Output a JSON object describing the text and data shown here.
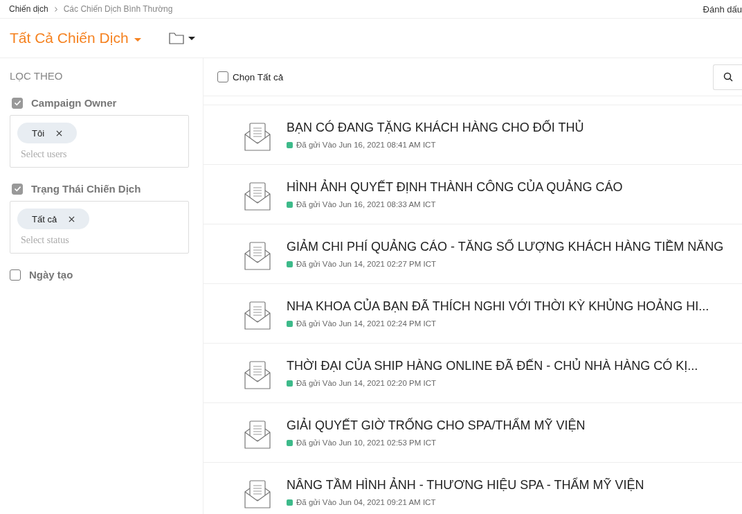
{
  "breadcrumb": {
    "items": [
      "Chiến dịch",
      "Các Chiến Dịch Bình Thường"
    ],
    "action": "Đánh dấu"
  },
  "header": {
    "title": "Tất Cả Chiến Dịch"
  },
  "filters": {
    "heading": "LỌC THEO",
    "groups": [
      {
        "label": "Campaign Owner",
        "checked": true,
        "chips": [
          "Tôi"
        ],
        "placeholder": "Select users"
      },
      {
        "label": "Trạng Thái Chiến Dịch",
        "checked": true,
        "chips": [
          "Tất cả"
        ],
        "placeholder": "Select status"
      },
      {
        "label": "Ngày tạo",
        "checked": false
      }
    ]
  },
  "toolbar": {
    "select_all": {
      "label": "Chọn Tất cả",
      "checked": false
    }
  },
  "campaigns": [
    {
      "title": "BẠN CÓ ĐANG TẶNG KHÁCH HÀNG CHO ĐỐI THỦ",
      "status": "Đã gửi Vào Jun 16, 2021 08:41 AM ICT",
      "color": "#3dba8a"
    },
    {
      "title": "HÌNH ẢNH QUYẾT ĐỊNH THÀNH CÔNG CỦA QUẢNG CÁO",
      "status": "Đã gửi Vào Jun 16, 2021 08:33 AM ICT",
      "color": "#3dba8a"
    },
    {
      "title": "GIẢM CHI PHÍ QUẢNG CÁO - TĂNG SỐ LƯỢNG KHÁCH HÀNG TIỀM NĂNG",
      "status": "Đã gửi Vào Jun 14, 2021 02:27 PM ICT",
      "color": "#3dba8a"
    },
    {
      "title": "NHA KHOA CỦA BẠN ĐÃ THÍCH NGHI VỚI THỜI KỲ KHỦNG HOẢNG HI...",
      "status": "Đã gửi Vào Jun 14, 2021 02:24 PM ICT",
      "color": "#3dba8a"
    },
    {
      "title": "THỜI ĐẠI CỦA SHIP HÀNG ONLINE ĐÃ ĐẾN - CHỦ NHÀ HÀNG CÓ KỊ...",
      "status": "Đã gửi Vào Jun 14, 2021 02:20 PM ICT",
      "color": "#3dba8a"
    },
    {
      "title": "GIẢI QUYẾT GIỜ TRỐNG CHO SPA/THẨM MỸ VIỆN",
      "status": "Đã gửi Vào Jun 10, 2021 02:53 PM ICT",
      "color": "#3dba8a"
    },
    {
      "title": "NÂNG TẦM HÌNH ẢNH - THƯƠNG HIỆU SPA - THẨM MỸ VIỆN",
      "status": "Đã gửi Vào Jun 04, 2021 09:21 AM ICT",
      "color": "#3dba8a"
    }
  ]
}
